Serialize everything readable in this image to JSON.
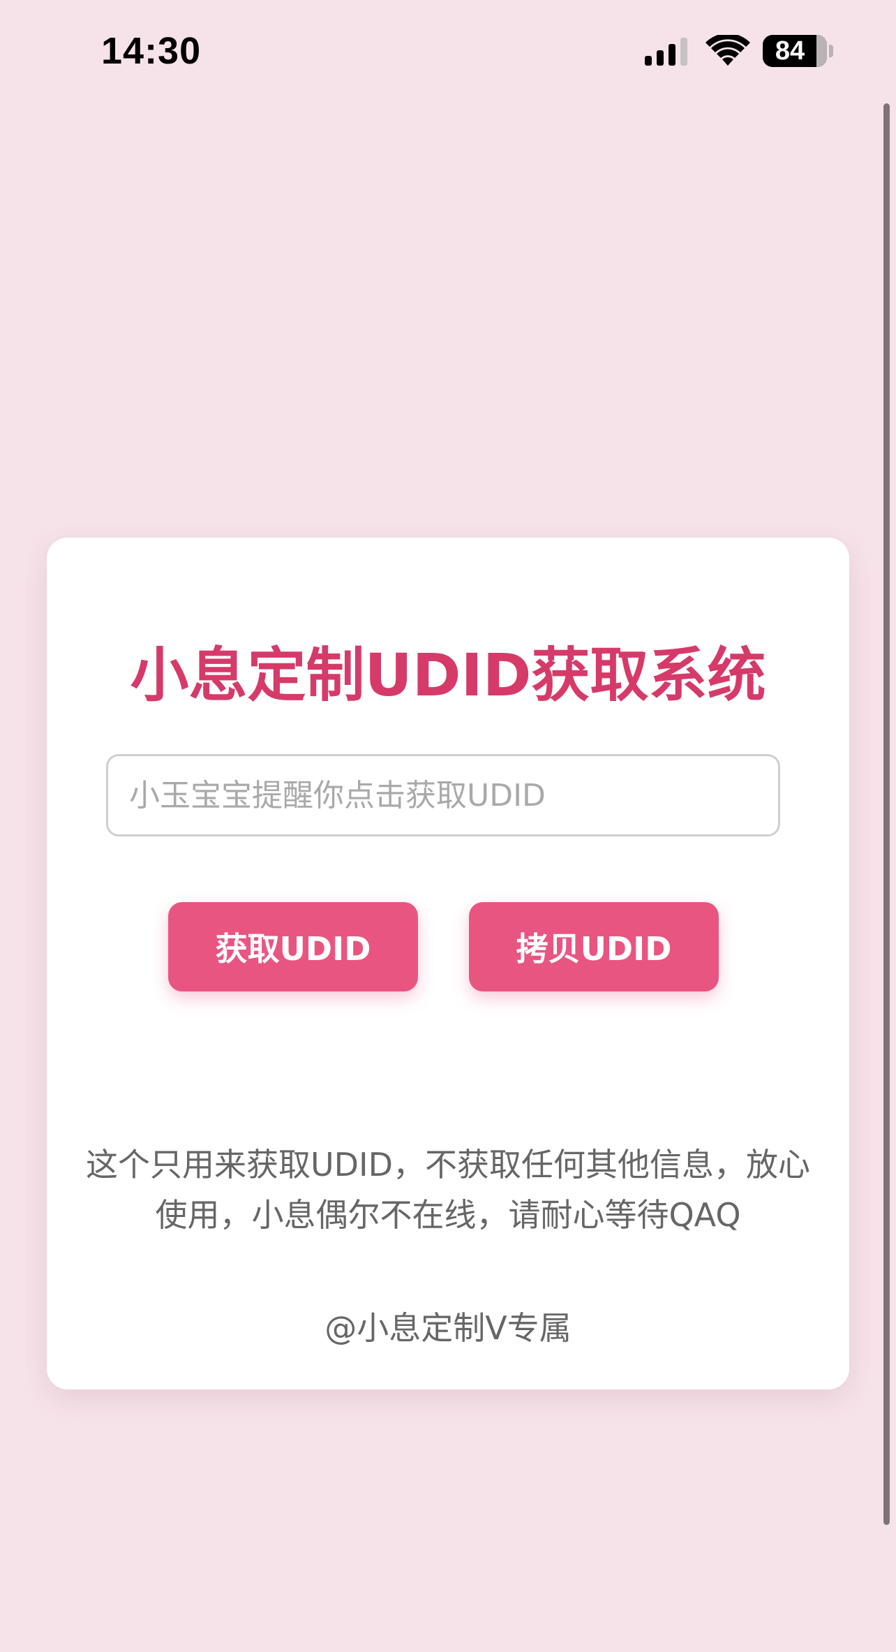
{
  "status_bar": {
    "time": "14:30",
    "battery_level": "84",
    "icons": [
      "signal-icon",
      "wifi-icon",
      "battery-icon"
    ]
  },
  "card": {
    "title": "小息定制UDID获取系统",
    "udid_input": {
      "value": "",
      "placeholder": "小玉宝宝提醒你点击获取UDID"
    },
    "get_button_label": "获取UDID",
    "copy_button_label": "拷贝UDID",
    "note": "这个只用来获取UDID，不获取任何其他信息，放心使用，小息偶尔不在线，请耐心等待QAQ",
    "footer": "@小息定制V专属"
  },
  "colors": {
    "background": "#f6e3e9",
    "title": "#d63a69",
    "button": "#e95581",
    "text_muted": "#666666"
  }
}
